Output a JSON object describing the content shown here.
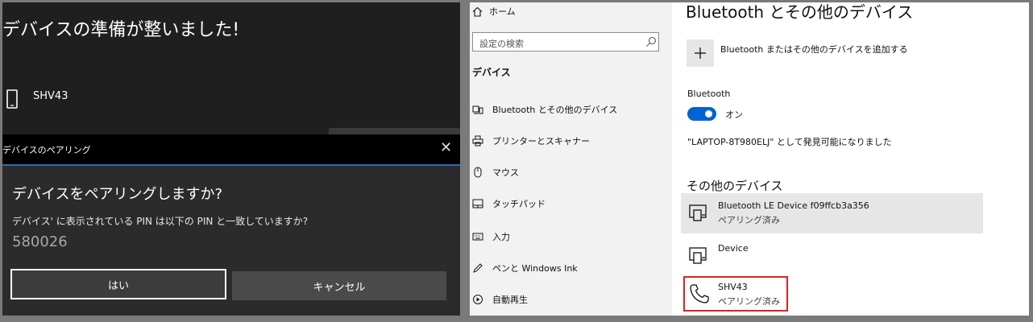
{
  "pairing_panel": {
    "ready_title": "デバイスの準備が整いました!",
    "device_name": "SHV43",
    "dialog_header": "デバイスのペアリング",
    "close_glyph": "✕",
    "question": "デバイスをペアリングしますか?",
    "subtitle": "デバイス' に表示されている PIN は以下の PIN と一致していますか?",
    "pin": "580026",
    "yes_label": "はい",
    "cancel_label": "キャンセル"
  },
  "sidebar": {
    "home_label": "ホーム",
    "search_placeholder": "設定の検索",
    "section_title": "デバイス",
    "items": [
      {
        "label": "Bluetooth とその他のデバイス",
        "icon": "bluetooth-devices-icon"
      },
      {
        "label": "プリンターとスキャナー",
        "icon": "printer-icon"
      },
      {
        "label": "マウス",
        "icon": "mouse-icon"
      },
      {
        "label": "タッチパッド",
        "icon": "touchpad-icon"
      },
      {
        "label": "入力",
        "icon": "keyboard-icon"
      },
      {
        "label": "ペンと Windows Ink",
        "icon": "pen-icon"
      },
      {
        "label": "自動再生",
        "icon": "autoplay-icon"
      }
    ]
  },
  "main": {
    "title": "Bluetooth とその他のデバイス",
    "add_label": "Bluetooth またはその他のデバイスを追加する",
    "bluetooth_label": "Bluetooth",
    "toggle_state": "オン",
    "discoverable_text": "\"LAPTOP-8T980ELJ\" として発見可能になりました",
    "other_devices_title": "その他のデバイス",
    "devices": [
      {
        "name": "Bluetooth LE Device f09ffcb3a356",
        "status": "ペアリング済み",
        "icon": "device-icon"
      },
      {
        "name": "Device",
        "status": "",
        "icon": "device-icon"
      },
      {
        "name": "SHV43",
        "status": "ペアリング済み",
        "icon": "phone-icon"
      }
    ]
  },
  "colors": {
    "accent": "#0063d1",
    "highlight_box": "#e02020",
    "dialog_header_line": "#2f66b5"
  }
}
